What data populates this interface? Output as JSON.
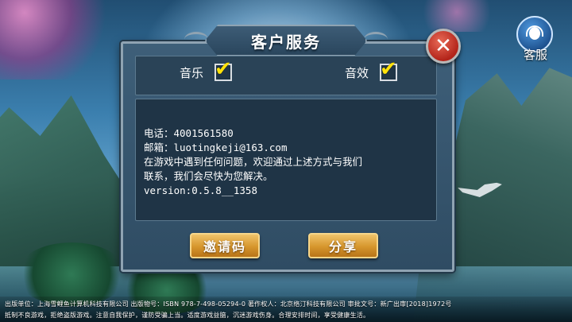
{
  "dialog": {
    "title": "客户服务",
    "toggles": [
      {
        "label": "音乐",
        "checked": true
      },
      {
        "label": "音效",
        "checked": true
      }
    ],
    "info_lines": [
      "电话：4001561580",
      "邮箱：luotingkeji@163.com",
      "在游戏中遇到任何问题，欢迎通过上述方式与我们",
      "联系，我们会尽快为您解决。",
      "version:0.5.8__1358"
    ],
    "buttons": {
      "invite": "邀请码",
      "share": "分享"
    },
    "close_icon": "close-icon"
  },
  "service": {
    "label": "客服",
    "icon": "headset-icon"
  },
  "footer": {
    "line1": "出版单位：上海雪鲤鱼计算机科技有限公司  出版物号：ISBN 978-7-498-05294-0  著作权人：北京络汀科技有限公司  审批文号：新广出审[2018]1972号",
    "line2": "抵制不良游戏，拒绝盗版游戏。注意自我保护，谨防受骗上当。适度游戏益脑，沉迷游戏伤身。合理安排时间，享受健康生活。"
  },
  "colors": {
    "accent_gold": "#d6962d",
    "check_yellow": "#ffe20a",
    "close_red": "#b3241a"
  }
}
